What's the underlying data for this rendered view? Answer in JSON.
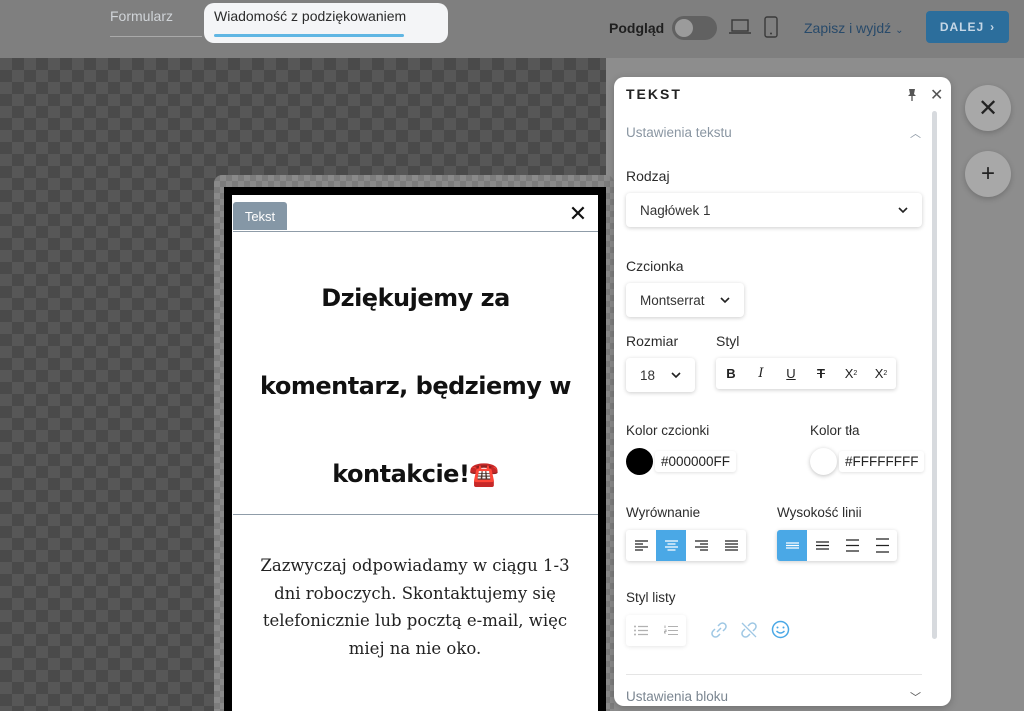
{
  "topbar": {
    "tab_form": "Formularz",
    "tab_thanks": "Wiadomość z podziękowaniem",
    "preview_label": "Podgląd",
    "save_exit": "Zapisz i wyjdź",
    "next_label": "DALEJ"
  },
  "canvas": {
    "block_tag": "Tekst",
    "heading_lines": [
      "Dziękujemy za",
      "komentarz, będziemy w",
      "kontakcie!☎️"
    ],
    "body_text": "Zazwyczaj odpowiadamy w ciągu 1-3 dni roboczych. Skontaktujemy się telefonicznie lub pocztą e-mail, więc miej na nie oko."
  },
  "panel": {
    "title": "TEKST",
    "section_text": "Ustawienia tekstu",
    "type_label": "Rodzaj",
    "type_value": "Nagłówek 1",
    "font_label": "Czcionka",
    "font_value": "Montserrat",
    "size_label": "Rozmiar",
    "size_value": "18",
    "style_label": "Styl",
    "font_color_label": "Kolor czcionki",
    "font_color_value": "#000000FF",
    "bg_color_label": "Kolor tła",
    "bg_color_value": "#FFFFFFFF",
    "align_label": "Wyrównanie",
    "line_height_label": "Wysokość linii",
    "list_style_label": "Styl listy",
    "section_block": "Ustawienia bloku"
  },
  "colors": {
    "accent": "#4aa8e6",
    "next_button": "#2c6e9c",
    "font_color": "#000000",
    "bg_color": "#FFFFFF"
  },
  "icons": [
    "laptop-icon",
    "phone-icon",
    "pin-icon",
    "close-icon",
    "plus-icon",
    "chevron-down-icon",
    "chevron-up-icon",
    "bold-icon",
    "italic-icon",
    "underline-icon",
    "strikethrough-icon",
    "subscript-icon",
    "superscript-icon",
    "align-left-icon",
    "align-center-icon",
    "align-right-icon",
    "align-justify-icon",
    "link-icon",
    "unlink-icon",
    "emoji-icon",
    "bullet-list-icon",
    "numbered-list-icon"
  ]
}
